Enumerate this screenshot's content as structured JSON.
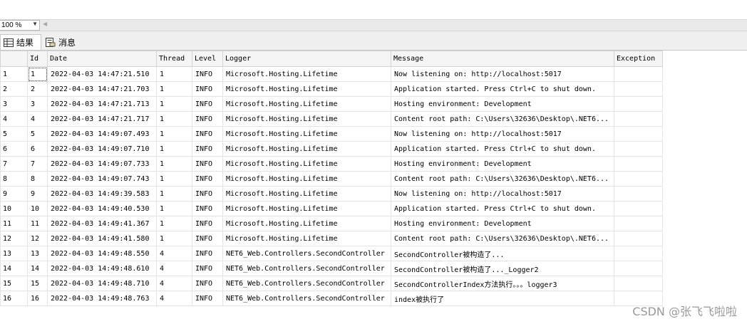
{
  "toolbar": {
    "zoom": "100 %"
  },
  "tabs": [
    {
      "label": "结果",
      "icon": "grid-icon"
    },
    {
      "label": "消息",
      "icon": "message-icon"
    }
  ],
  "grid": {
    "columns": [
      "",
      "Id",
      "Date",
      "Thread",
      "Level",
      "Logger",
      "Message",
      "Exception"
    ],
    "rows": [
      [
        "1",
        "1",
        "2022-04-03 14:47:21.510",
        "1",
        "INFO",
        "Microsoft.Hosting.Lifetime",
        "Now listening on: http://localhost:5017",
        ""
      ],
      [
        "2",
        "2",
        "2022-04-03 14:47:21.703",
        "1",
        "INFO",
        "Microsoft.Hosting.Lifetime",
        "Application started. Press Ctrl+C to shut down.",
        ""
      ],
      [
        "3",
        "3",
        "2022-04-03 14:47:21.713",
        "1",
        "INFO",
        "Microsoft.Hosting.Lifetime",
        "Hosting environment: Development",
        ""
      ],
      [
        "4",
        "4",
        "2022-04-03 14:47:21.717",
        "1",
        "INFO",
        "Microsoft.Hosting.Lifetime",
        "Content root path: C:\\Users\\32636\\Desktop\\.NET6...",
        ""
      ],
      [
        "5",
        "5",
        "2022-04-03 14:49:07.493",
        "1",
        "INFO",
        "Microsoft.Hosting.Lifetime",
        "Now listening on: http://localhost:5017",
        ""
      ],
      [
        "6",
        "6",
        "2022-04-03 14:49:07.710",
        "1",
        "INFO",
        "Microsoft.Hosting.Lifetime",
        "Application started. Press Ctrl+C to shut down.",
        ""
      ],
      [
        "7",
        "7",
        "2022-04-03 14:49:07.733",
        "1",
        "INFO",
        "Microsoft.Hosting.Lifetime",
        "Hosting environment: Development",
        ""
      ],
      [
        "8",
        "8",
        "2022-04-03 14:49:07.743",
        "1",
        "INFO",
        "Microsoft.Hosting.Lifetime",
        "Content root path: C:\\Users\\32636\\Desktop\\.NET6...",
        ""
      ],
      [
        "9",
        "9",
        "2022-04-03 14:49:39.583",
        "1",
        "INFO",
        "Microsoft.Hosting.Lifetime",
        "Now listening on: http://localhost:5017",
        ""
      ],
      [
        "10",
        "10",
        "2022-04-03 14:49:40.530",
        "1",
        "INFO",
        "Microsoft.Hosting.Lifetime",
        "Application started. Press Ctrl+C to shut down.",
        ""
      ],
      [
        "11",
        "11",
        "2022-04-03 14:49:41.367",
        "1",
        "INFO",
        "Microsoft.Hosting.Lifetime",
        "Hosting environment: Development",
        ""
      ],
      [
        "12",
        "12",
        "2022-04-03 14:49:41.580",
        "1",
        "INFO",
        "Microsoft.Hosting.Lifetime",
        "Content root path: C:\\Users\\32636\\Desktop\\.NET6...",
        ""
      ],
      [
        "13",
        "13",
        "2022-04-03 14:49:48.550",
        "4",
        "INFO",
        "NET6_Web.Controllers.SecondController",
        "SecondController被构造了...",
        ""
      ],
      [
        "14",
        "14",
        "2022-04-03 14:49:48.610",
        "4",
        "INFO",
        "NET6_Web.Controllers.SecondController",
        "SecondController被构造了..._Logger2",
        ""
      ],
      [
        "15",
        "15",
        "2022-04-03 14:49:48.710",
        "4",
        "INFO",
        "NET6_Web.Controllers.SecondController",
        "SecondControllerIndex方法执行。。。logger3",
        ""
      ],
      [
        "16",
        "16",
        "2022-04-03 14:49:48.763",
        "4",
        "INFO",
        "NET6_Web.Controllers.SecondController",
        "index被执行了",
        ""
      ]
    ]
  },
  "watermark": "CSDN @张飞飞啦啦"
}
